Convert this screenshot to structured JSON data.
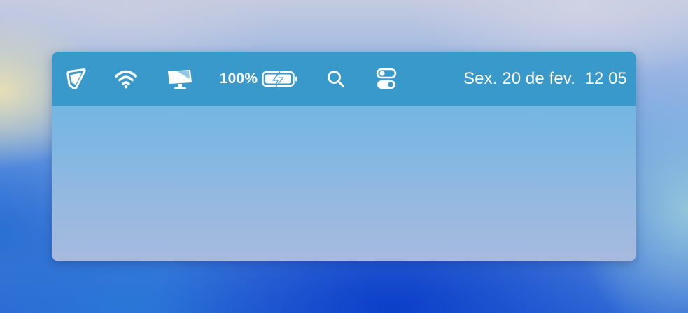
{
  "menubar": {
    "icons": [
      "app-icon",
      "wifi-icon",
      "display-mirroring-icon",
      "battery-charging-icon",
      "search-icon",
      "control-center-icon"
    ],
    "battery": {
      "percent_label": "100%",
      "level": 1.0,
      "charging": true
    },
    "clock": {
      "text": "Sex. 20 de fev.  12 05"
    }
  },
  "colors": {
    "menubar_bg": "#3999ca",
    "panel_top": "#66b5e6",
    "panel_bottom": "#a6bade",
    "foreground": "#ffffff"
  }
}
